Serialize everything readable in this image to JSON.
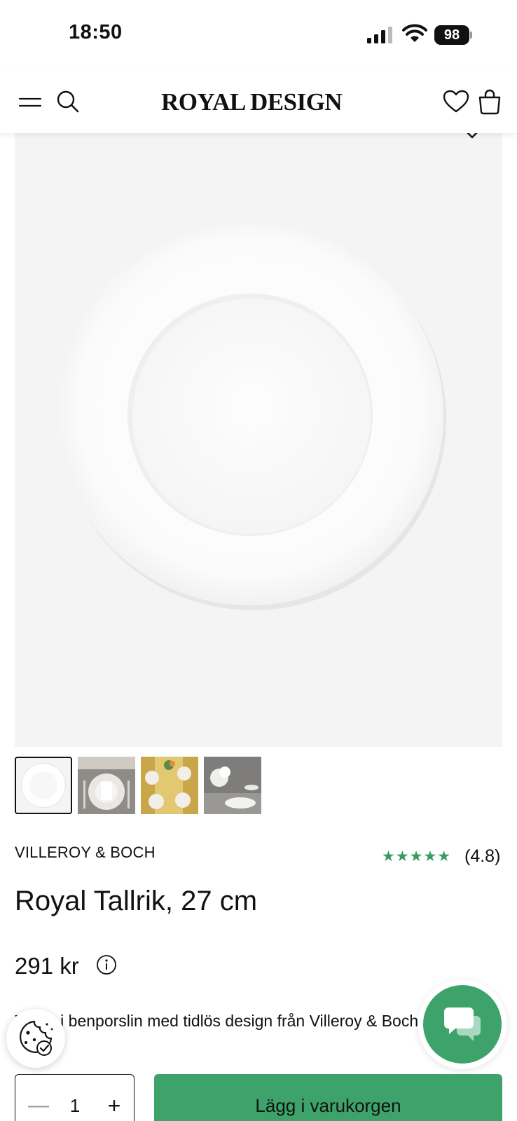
{
  "status_bar": {
    "time": "18:50",
    "battery": "98"
  },
  "header": {
    "logo": "ROYAL DESIGN"
  },
  "product": {
    "brand": "VILLEROY & BOCH",
    "stars": "★★★★★",
    "rating": "(4.8)",
    "title": "Royal Tallrik, 27 cm",
    "price": "291 kr",
    "description": "Tallrik i benporslin med tidlös design från Villeroy & Boch."
  },
  "cart": {
    "quantity": "1",
    "minus": "—",
    "plus": "+",
    "add_label": "Lägg i varukorgen"
  },
  "colors": {
    "accent": "#3ea36b",
    "stars": "#3b9a62",
    "image_bg": "#f4f4f4"
  },
  "icons": [
    "menu-icon",
    "search-icon",
    "heart-icon",
    "bag-icon",
    "chevron-down-icon",
    "info-icon",
    "cookie-icon",
    "chat-icon",
    "signal-icon",
    "wifi-icon"
  ]
}
